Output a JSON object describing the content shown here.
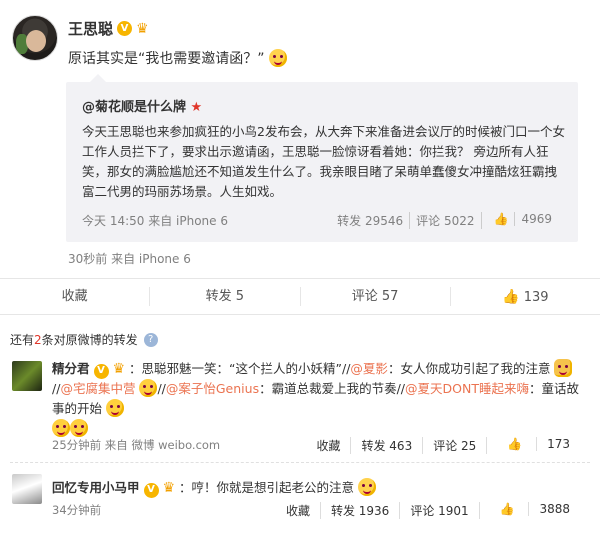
{
  "post": {
    "username": "王思聪",
    "v_badge": "V",
    "crown_icon": "crown-icon",
    "text": "原话其实是“我也需要邀请函？”",
    "meta": "30秒前 来自 iPhone 6"
  },
  "repost": {
    "author": "@菊花顺是什么牌",
    "body": "今天王思聪也来参加疯狂的小鸟2发布会，从大奔下来准备进会议厅的时候被门口一个女工作人员拦下了，要求出示邀请函，王思聪一脸惊讶看着她：你拦我？ 旁边所有人狂笑，那女的满脸尴尬还不知道发生什么了。我亲眼目睹了呆萌单蠢傻女冲撞酷炫狂霸拽富二代男的玛丽苏场景。人生如戏。",
    "meta": "今天 14:50 来自 iPhone 6",
    "repost_label": "转发 29546",
    "comment_label": "评论 5022",
    "like_count": "4969"
  },
  "actions": {
    "collect": "收藏",
    "repost": "转发 5",
    "comment": "评论 57",
    "like": "139"
  },
  "others": {
    "prefix": "还有",
    "count": "2",
    "suffix": "条对原微博的转发"
  },
  "comments": [
    {
      "name": "精分君",
      "part1": "：思聪邪魅一笑：“这个拦人的小妖精”//",
      "mention1": "@夏影",
      "part2": "：女人你成功引起了我的注意",
      "part3": "//",
      "mention2": "@宅腐集中营",
      "part4": "//",
      "mention3": "@案子怡Genius",
      "part5": "：霸道总裁爱上我的节奏//",
      "mention4": "@夏天DONT睡起来嗨",
      "part6": "：童话故事的开始",
      "time": "25分钟前 来自 微博 weibo.com",
      "collect": "收藏",
      "repost": "转发 463",
      "comment": "评论 25",
      "like": "173"
    },
    {
      "name": "回忆专用小马甲",
      "text": "：哼！你就是想引起老公的注意",
      "time": "34分钟前",
      "collect": "收藏",
      "repost": "转发 1936",
      "comment": "评论 1901",
      "like": "3888"
    }
  ]
}
